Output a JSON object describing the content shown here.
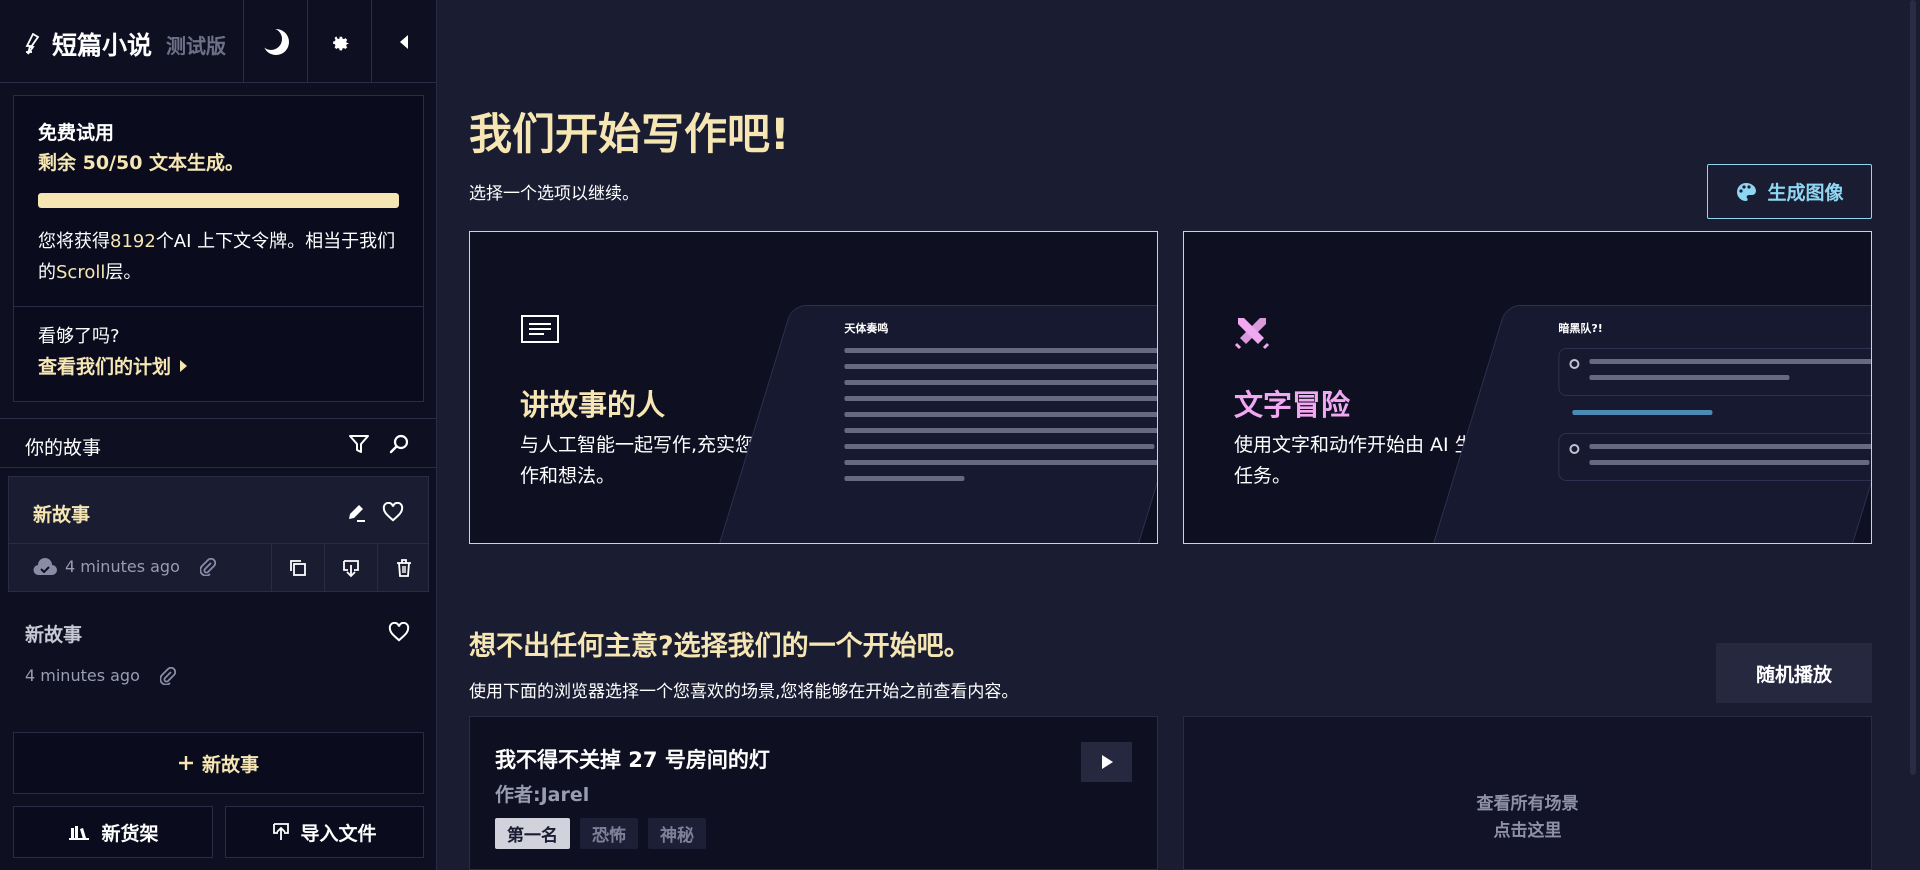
{
  "brand": {
    "name": "短篇小说",
    "tag": "测试版"
  },
  "trial": {
    "title": "免费试用",
    "remaining": "剩余 50/50 文本生成。",
    "progress_fraction": 1.0,
    "desc_prefix": "您将获得",
    "desc_tokens": "8192",
    "desc_mid": "个AI 上下文令牌。相当于我们的",
    "desc_tier": "Scroll",
    "desc_suffix": "层。",
    "question": "看够了吗?",
    "plans_link": "查看我们的计划"
  },
  "stories": {
    "header": "你的故事",
    "items": [
      {
        "name": "新故事",
        "time": "4 minutes ago"
      },
      {
        "name": "新故事",
        "time": "4 minutes ago"
      }
    ],
    "new_story": "新故事",
    "new_shelf": "新货架",
    "import_file": "导入文件"
  },
  "main": {
    "title": "我们开始写作吧!",
    "subtitle": "选择一个选项以继续。",
    "generate_image": "生成图像",
    "modes": [
      {
        "title": "讲故事的人",
        "desc": "与人工智能一起写作,充实您的写作和想法。",
        "preview_title": "天体奏鸣",
        "color": "#f5e6b3"
      },
      {
        "title": "文字冒险",
        "desc": "使用文字和动作开始由 AI 生成的任务。",
        "preview_title": "暗黑队?!",
        "color": "#f0a8f0"
      }
    ],
    "ideas_title": "想不出任何主意?选择我们的一个开始吧。",
    "ideas_sub": "使用下面的浏览器选择一个您喜欢的场景,您将能够在开始之前查看内容。",
    "random": "随机播放",
    "scenario": {
      "title": "我不得不关掉 27 号房间的灯",
      "author": "作者:Jarel",
      "tags": [
        "第一名",
        "恐怖",
        "神秘"
      ]
    },
    "view_all": {
      "line1": "查看所有场景",
      "line2": "点击这里"
    }
  },
  "colors": {
    "accent": "#f5e6b3",
    "link_blue": "#8fd6f2",
    "adventure_pink": "#f0a8f0",
    "bg": "#1a1c32",
    "sidebar_bg": "#0e0f21"
  }
}
